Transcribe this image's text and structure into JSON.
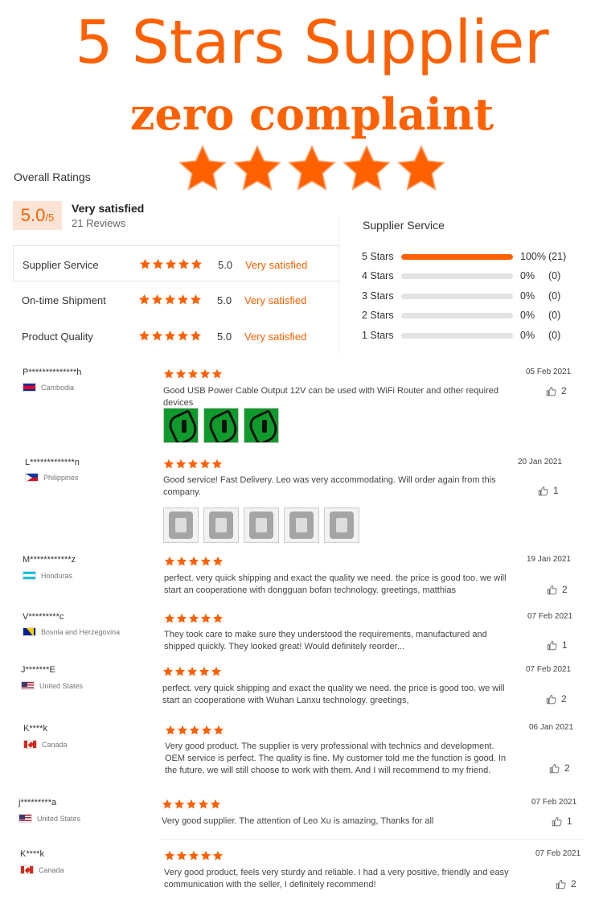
{
  "banner": {
    "title": "5 Stars Supplier",
    "subtitle": "zero complaint",
    "star_count": 5,
    "star_color": "#ff6000"
  },
  "summary": {
    "overall_label": "Overall Ratings",
    "score": "5.0",
    "score_max": "/5",
    "verdict": "Very satisfied",
    "reviews": "21 Reviews"
  },
  "criteria": [
    {
      "name": "Supplier Service",
      "rating": 5,
      "score": "5.0",
      "verdict": "Very satisfied"
    },
    {
      "name": "On-time Shipment",
      "rating": 5,
      "score": "5.0",
      "verdict": "Very satisfied"
    },
    {
      "name": "Product Quality",
      "rating": 5,
      "score": "5.0",
      "verdict": "Very satisfied"
    }
  ],
  "service": {
    "title": "Supplier Service",
    "bars": [
      {
        "label": "5 Stars",
        "fraction": 1.0,
        "pct": "100%",
        "count": "(21)"
      },
      {
        "label": "4 Stars",
        "fraction": 0,
        "pct": "0%",
        "count": "(0)"
      },
      {
        "label": "3 Stars",
        "fraction": 0,
        "pct": "0%",
        "count": "(0)"
      },
      {
        "label": "2 Stars",
        "fraction": 0,
        "pct": "0%",
        "count": "(0)"
      },
      {
        "label": "1 Stars",
        "fraction": 0,
        "pct": "0%",
        "count": "(0)"
      }
    ]
  },
  "reviews": [
    {
      "user": "P**************h",
      "country": "Cambodia",
      "flag": "cambodia",
      "rating": 5,
      "date": "05 Feb 2021",
      "text": "Good USB Power Cable Output 12V can be used with WiFi Router and other required devices",
      "likes": "2"
    },
    {
      "user": "L*************n",
      "country": "Philippines",
      "flag": "philippines",
      "rating": 5,
      "date": "20 Jan 2021",
      "text": "Good service! Fast Delivery. Leo was very accommodating. Will order again from this company.",
      "likes": "1"
    },
    {
      "user": "M************z",
      "country": "Honduras",
      "flag": "honduras",
      "rating": 5,
      "date": "19 Jan 2021",
      "text": "perfect. very quick shipping and exact the quality we need. the price is good too. we will start an cooperatione with dongguan bofan technology. greetings, matthias",
      "likes": "2"
    },
    {
      "user": "V*********c",
      "country": "Bosnia and Herzegovina",
      "flag": "bosnia",
      "rating": 5,
      "date": "07 Feb 2021",
      "text": "They took care to make sure they understood the requirements, manufactured and shipped quickly. They looked great! Would definitely reorder...",
      "likes": "1"
    },
    {
      "user": "J*******E",
      "country": "United States",
      "flag": "usa",
      "rating": 5,
      "date": "07 Feb 2021",
      "text": "perfect. very quick shipping and exact the quality we need. the price is good too. we will start an cooperatione with Wuhan Lanxu technology. greetings,",
      "likes": "2"
    },
    {
      "user": "K****k",
      "country": "Canada",
      "flag": "canada",
      "rating": 5,
      "date": "06 Jan 2021",
      "text": "Very good product. The supplier is very professional with technics and development. OEM service is perfect. The quality is fine. My customer told me the function is good. In the future, we will still choose to work with them. And I will recommend to my friend.",
      "likes": "2"
    },
    {
      "user": "j*********a",
      "country": "United States",
      "flag": "usa",
      "rating": 5,
      "date": "07 Feb 2021",
      "text": "Very good supplier. The attention of Leo Xu is amazing, Thanks for all",
      "likes": "1"
    },
    {
      "user": "K****k",
      "country": "Canada",
      "flag": "canada",
      "rating": 5,
      "date": "07 Feb 2021",
      "text": "Very good product, feels very sturdy and reliable. I had a very positive, friendly and easy communication with the seller, I definitely recommend!",
      "likes": "2"
    }
  ]
}
